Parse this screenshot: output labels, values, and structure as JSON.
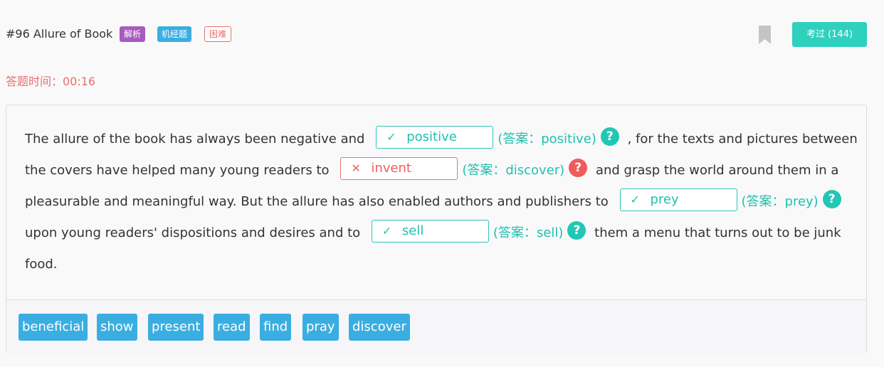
{
  "header": {
    "title": "#96 Allure of Book",
    "tags": [
      "解析",
      "机经题",
      "困难"
    ],
    "bookmark_icon": "bookmark-icon",
    "pass_button": "考过 (144)"
  },
  "timer": "答题时间：00:16",
  "passage": {
    "seg1": "The allure of the book has always been negative and",
    "blank1": {
      "value": "positive",
      "answer": "(答案：positive)",
      "status": "correct"
    },
    "seg2": ", for the texts and pictures between the covers have helped many young readers to",
    "blank2": {
      "value": "invent",
      "answer": "(答案：discover)",
      "status": "wrong"
    },
    "seg3": "and grasp the world around them in a pleasurable and meaningful way. But the allure has also enabled authors and publishers to",
    "blank3": {
      "value": "prey",
      "answer": "(答案：prey)",
      "status": "correct"
    },
    "seg4": "upon young readers' dispositions and desires and to",
    "blank4": {
      "value": "sell",
      "answer": "(答案：sell)",
      "status": "correct"
    },
    "seg5": "them a menu that turns out to be junk food."
  },
  "icons": {
    "check": "✓",
    "cross": "✕",
    "help": "?"
  },
  "word_bank": [
    "beneficial",
    "show",
    "present",
    "read",
    "find",
    "pray",
    "discover"
  ],
  "colors": {
    "accent": "#2ed0be",
    "correct": "#22c0b0",
    "wrong": "#ee5f5f",
    "chip": "#3aaee0",
    "timer": "#ee6e6e"
  }
}
